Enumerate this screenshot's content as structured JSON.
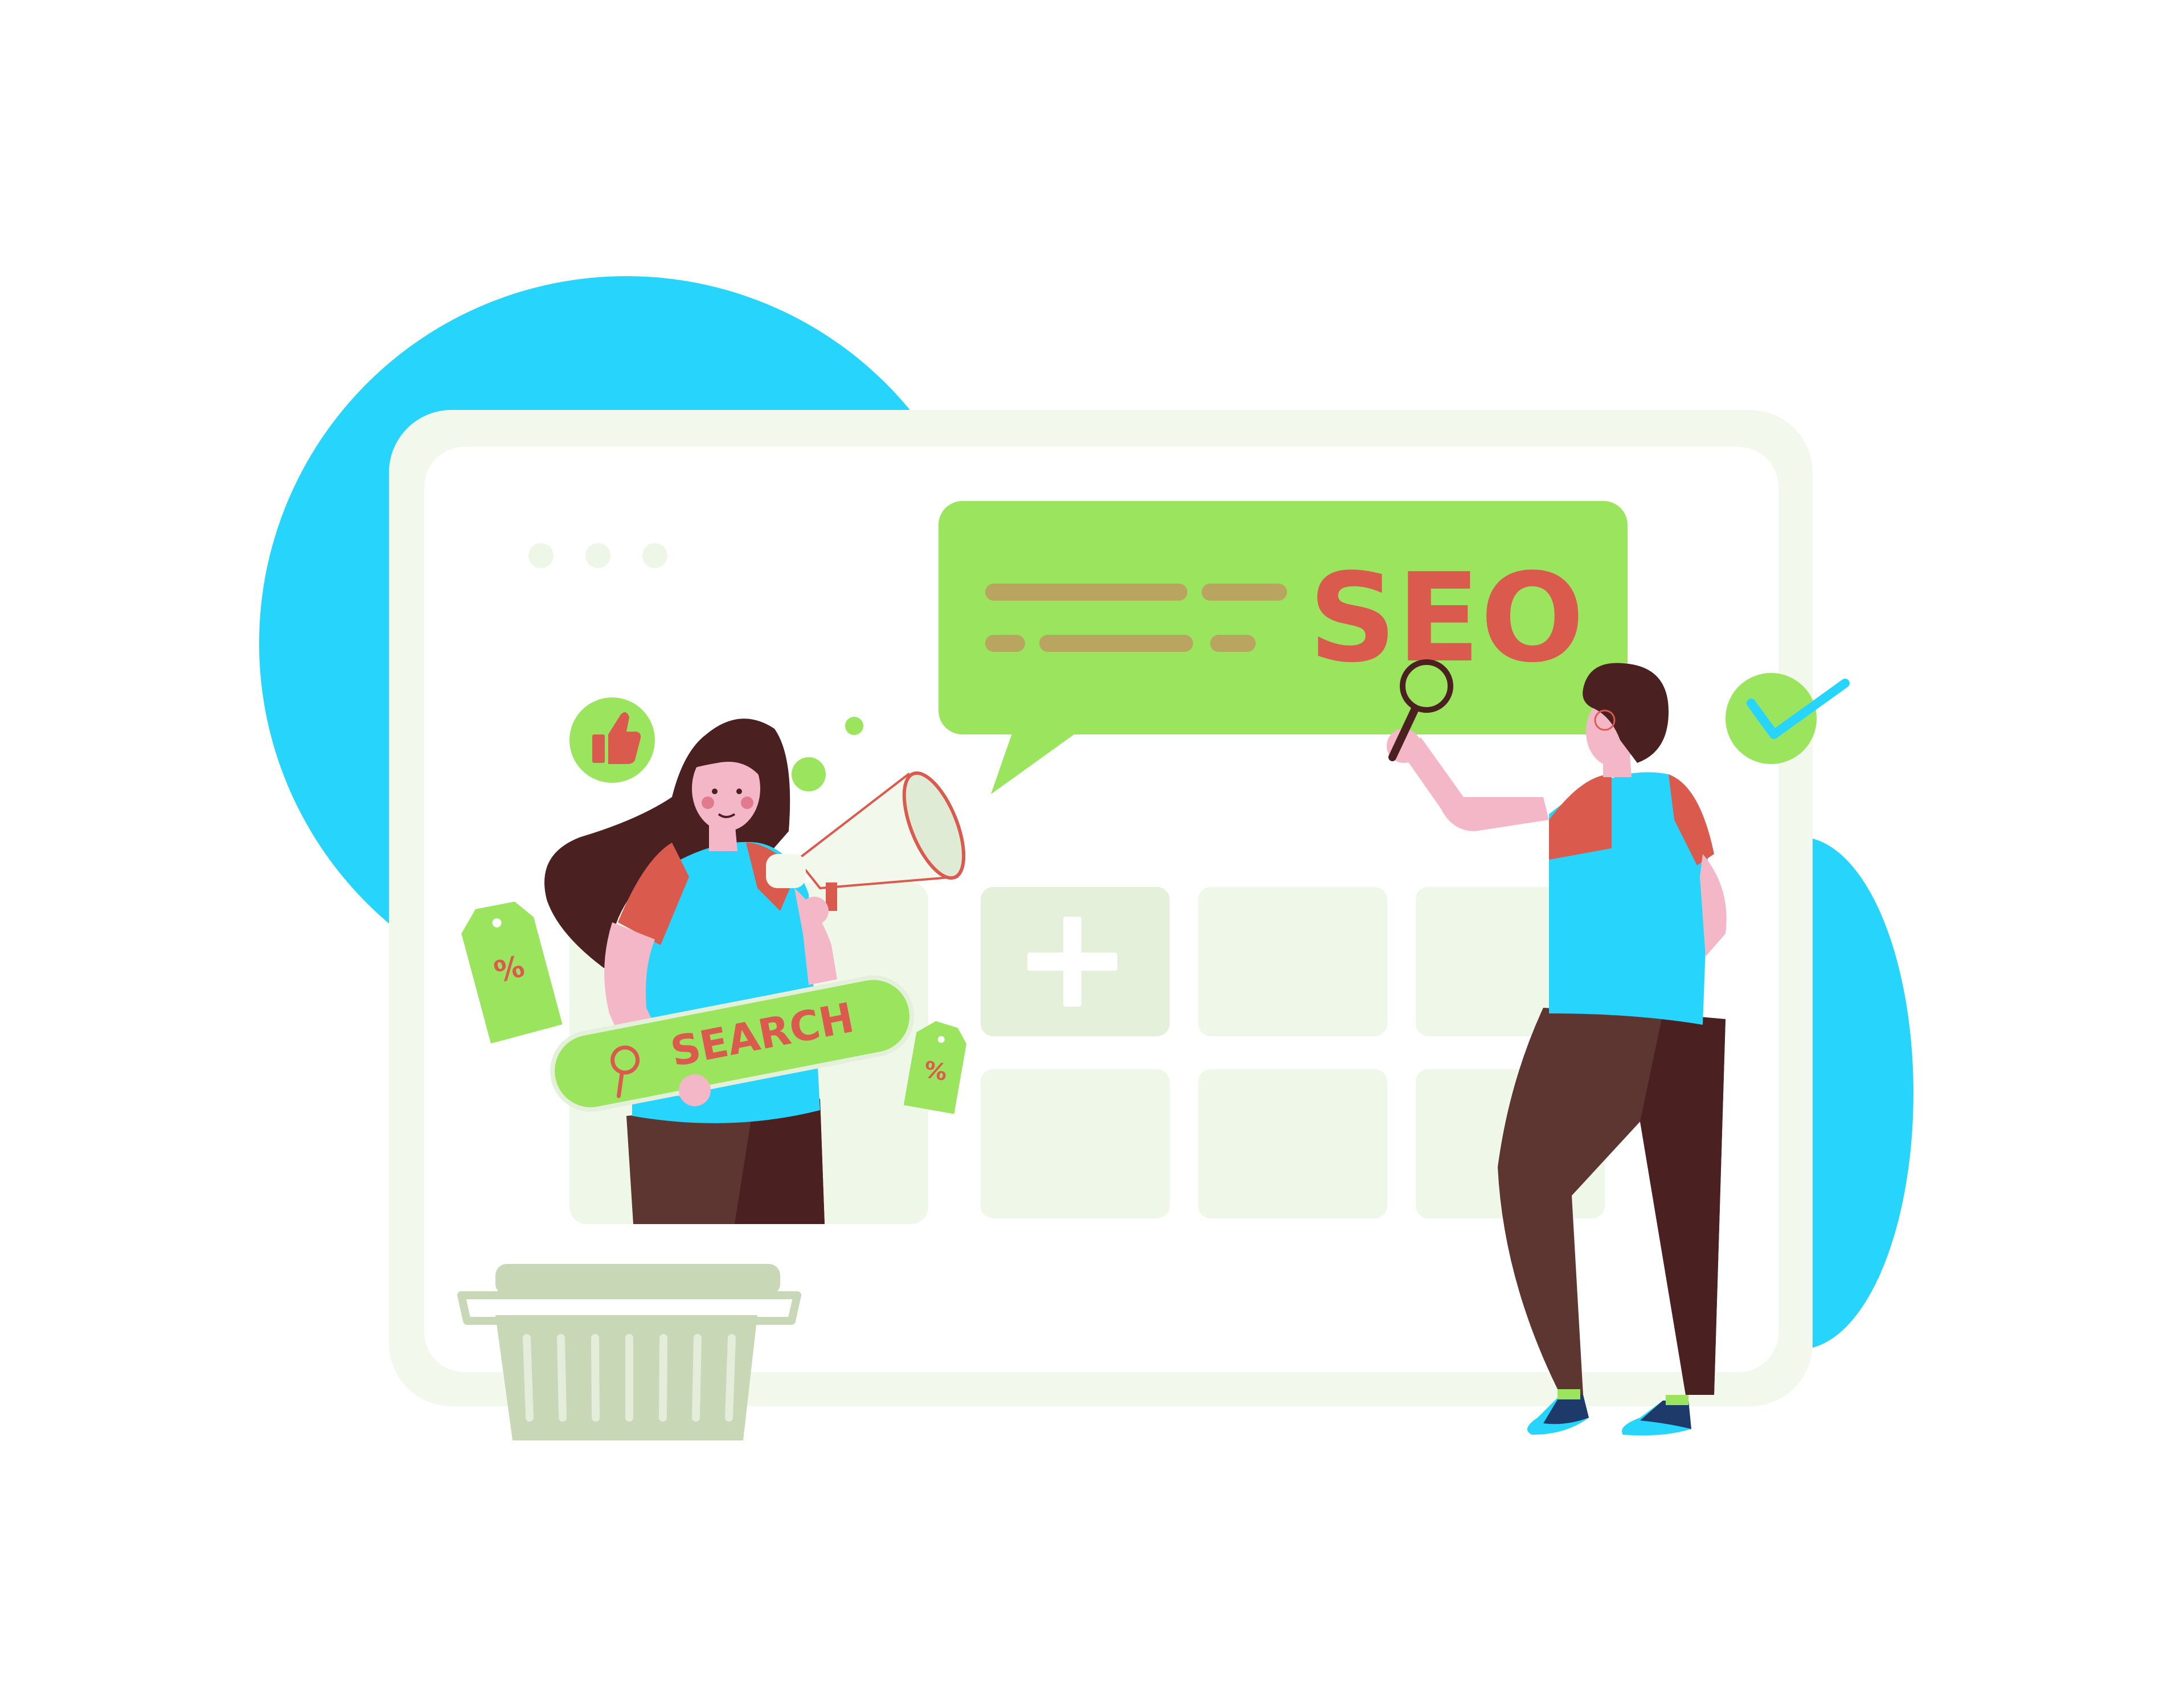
{
  "speech_bubble": {
    "label": "SEO"
  },
  "search_bar": {
    "label": "SEARCH"
  },
  "price_tags": [
    {
      "label": "%"
    },
    {
      "label": "%"
    }
  ],
  "window": {
    "dots": 3,
    "grid_tiles": 6
  },
  "icons": [
    "thumbs-up-icon",
    "check-icon",
    "plus-icon",
    "magnifier-icon",
    "megaphone-icon",
    "shopping-basket-icon"
  ],
  "colors": {
    "background_blob": "#27D4FB",
    "window_frame": "#F2F8EC",
    "window_inner": "#FFFFFF",
    "tile": "#EFF7E9",
    "accent_green": "#9AE45E",
    "text_red": "#DB5A4E",
    "line_olive": "#B9A460",
    "hair_dark": "#4A2020",
    "skin": "#F4B7C8",
    "shirt_blue": "#27D4FB",
    "pants_brown": "#5D3531"
  }
}
